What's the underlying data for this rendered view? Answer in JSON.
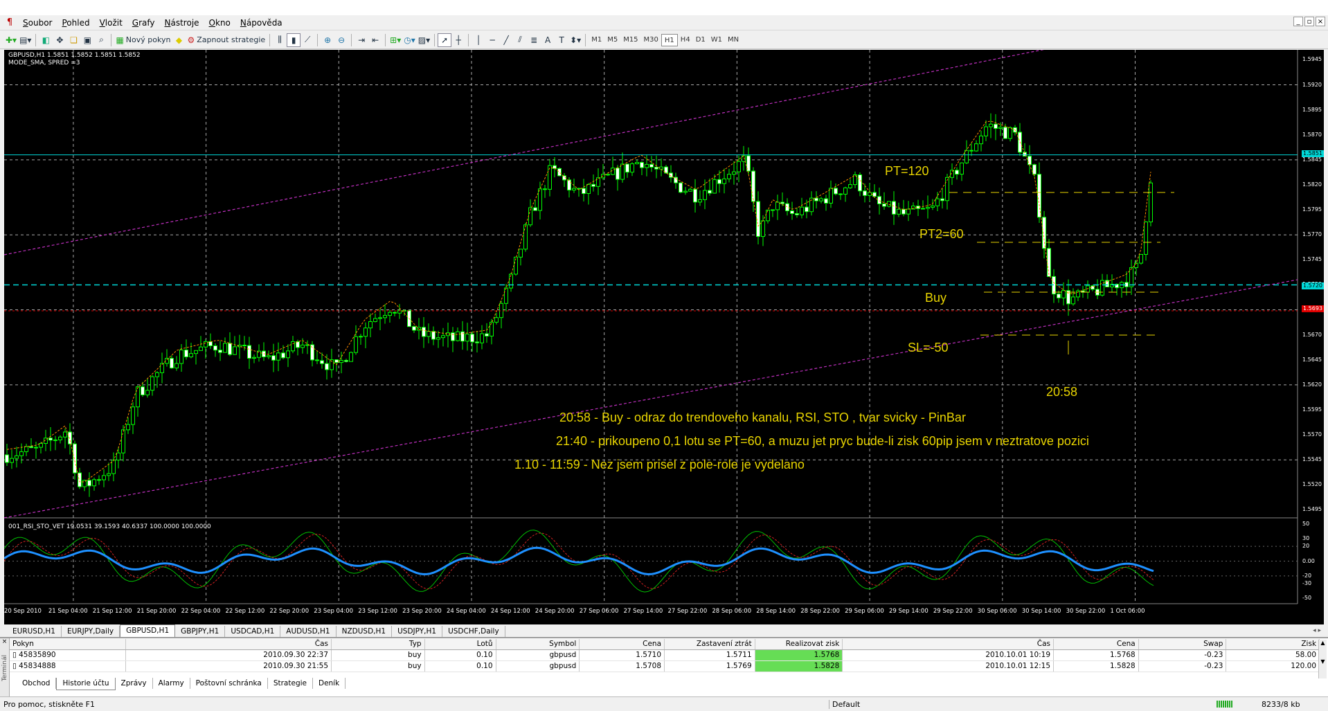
{
  "menu": [
    "Soubor",
    "Pohled",
    "Vložit",
    "Grafy",
    "Nástroje",
    "Okno",
    "Nápověda"
  ],
  "window_controls": [
    "_",
    "▫",
    "×"
  ],
  "toolbar": {
    "new_order_label": "Nový pokyn",
    "strategy_label": "Zapnout strategie",
    "timeframes": [
      "M1",
      "M5",
      "M15",
      "M30",
      "H1",
      "H4",
      "D1",
      "W1",
      "MN"
    ],
    "active_timeframe": "H1"
  },
  "chart": {
    "symbol_info": "GBPUSD,H1  1.5851 1.5852 1.5851 1.5852",
    "indicator_info": "MODE_SMA, SPRED =3",
    "osc_info": "001_RSI_STO_VET 19.0531 39.1593 40.6337 100.0000 100.0000",
    "price_axis": [
      "1.5945",
      "1.5920",
      "1.5895",
      "1.5870",
      "1.5845",
      "1.5820",
      "1.5795",
      "1.5770",
      "1.5745",
      "1.5720",
      "1.5695",
      "1.5670",
      "1.5645",
      "1.5620",
      "1.5595",
      "1.5570",
      "1.5545",
      "1.5520",
      "1.5495"
    ],
    "osc_axis": [
      "50",
      "30",
      "20",
      "0.00",
      "-20",
      "-30",
      "-50"
    ],
    "time_axis": [
      "20 Sep 2010",
      "21 Sep 04:00",
      "21 Sep 12:00",
      "21 Sep 20:00",
      "22 Sep 04:00",
      "22 Sep 12:00",
      "22 Sep 20:00",
      "23 Sep 04:00",
      "23 Sep 12:00",
      "23 Sep 20:00",
      "24 Sep 04:00",
      "24 Sep 12:00",
      "24 Sep 20:00",
      "27 Sep 06:00",
      "27 Sep 14:00",
      "27 Sep 22:00",
      "28 Sep 06:00",
      "28 Sep 14:00",
      "28 Sep 22:00",
      "29 Sep 06:00",
      "29 Sep 14:00",
      "29 Sep 22:00",
      "30 Sep 06:00",
      "30 Sep 14:00",
      "30 Sep 22:00",
      "1 Oct 06:00"
    ],
    "current_price_tag": "1.5851",
    "level_tag_cyan": "1.5720",
    "level_tag_red": "1.5693",
    "colors": {
      "up": "#00ff00",
      "down": "#00ff00",
      "cyan_level": "#00d8d8",
      "red_level": "#e00000",
      "channel": "#c030c0",
      "annotation": "#e8d400",
      "rsi_line": "#1e90ff"
    },
    "annotations": {
      "pt120": "PT=120",
      "pt2": "PT2=60",
      "buy": "Buy",
      "sl": "SL=-50",
      "time": "20:58",
      "note1": "20:58 - Buy - odraz do trendoveho kanalu, RSI, STO  , tvar svicky - PinBar",
      "note2": "21:40 - prikoupeno 0,1 lotu se PT=60, a muzu jet pryc bude-li zisk 60pip jsem v neztratove pozici",
      "note3": "1.10 - 11:59 - Nez jsem prisel z pole-role je vydelano"
    }
  },
  "symbol_tabs": [
    "EURUSD,H1",
    "EURJPY,Daily",
    "GBPUSD,H1",
    "GBPJPY,H1",
    "USDCAD,H1",
    "AUDUSD,H1",
    "NZDUSD,H1",
    "USDJPY,H1",
    "USDCHF,Daily"
  ],
  "active_symbol_tab": "GBPUSD,H1",
  "terminal": {
    "headers": [
      "Pokyn",
      "Čas",
      "Typ",
      "Lotů",
      "Symbol",
      "Cena",
      "Zastavení ztrát",
      "Realizovat zisk",
      "Čas",
      "Cena",
      "Swap",
      "Zisk"
    ],
    "rows": [
      [
        "45835890",
        "2010.09.30 22:37",
        "buy",
        "0.10",
        "gbpusd",
        "1.5710",
        "1.5711",
        "1.5768",
        "2010.10.01 10:19",
        "1.5768",
        "-0.23",
        "58.00"
      ],
      [
        "45834888",
        "2010.09.30 21:55",
        "buy",
        "0.10",
        "gbpusd",
        "1.5708",
        "1.5769",
        "1.5828",
        "2010.10.01 12:15",
        "1.5828",
        "-0.23",
        "120.00"
      ]
    ],
    "tabs": [
      "Obchod",
      "Historie účtu",
      "Zprávy",
      "Alarmy",
      "Poštovní schránka",
      "Strategie",
      "Deník"
    ],
    "active_tab": "Historie účtu",
    "side_label": "Terminál"
  },
  "status": {
    "help": "Pro pomoc, stiskněte F1",
    "profile": "Default",
    "traffic": "8233/8 kb"
  }
}
